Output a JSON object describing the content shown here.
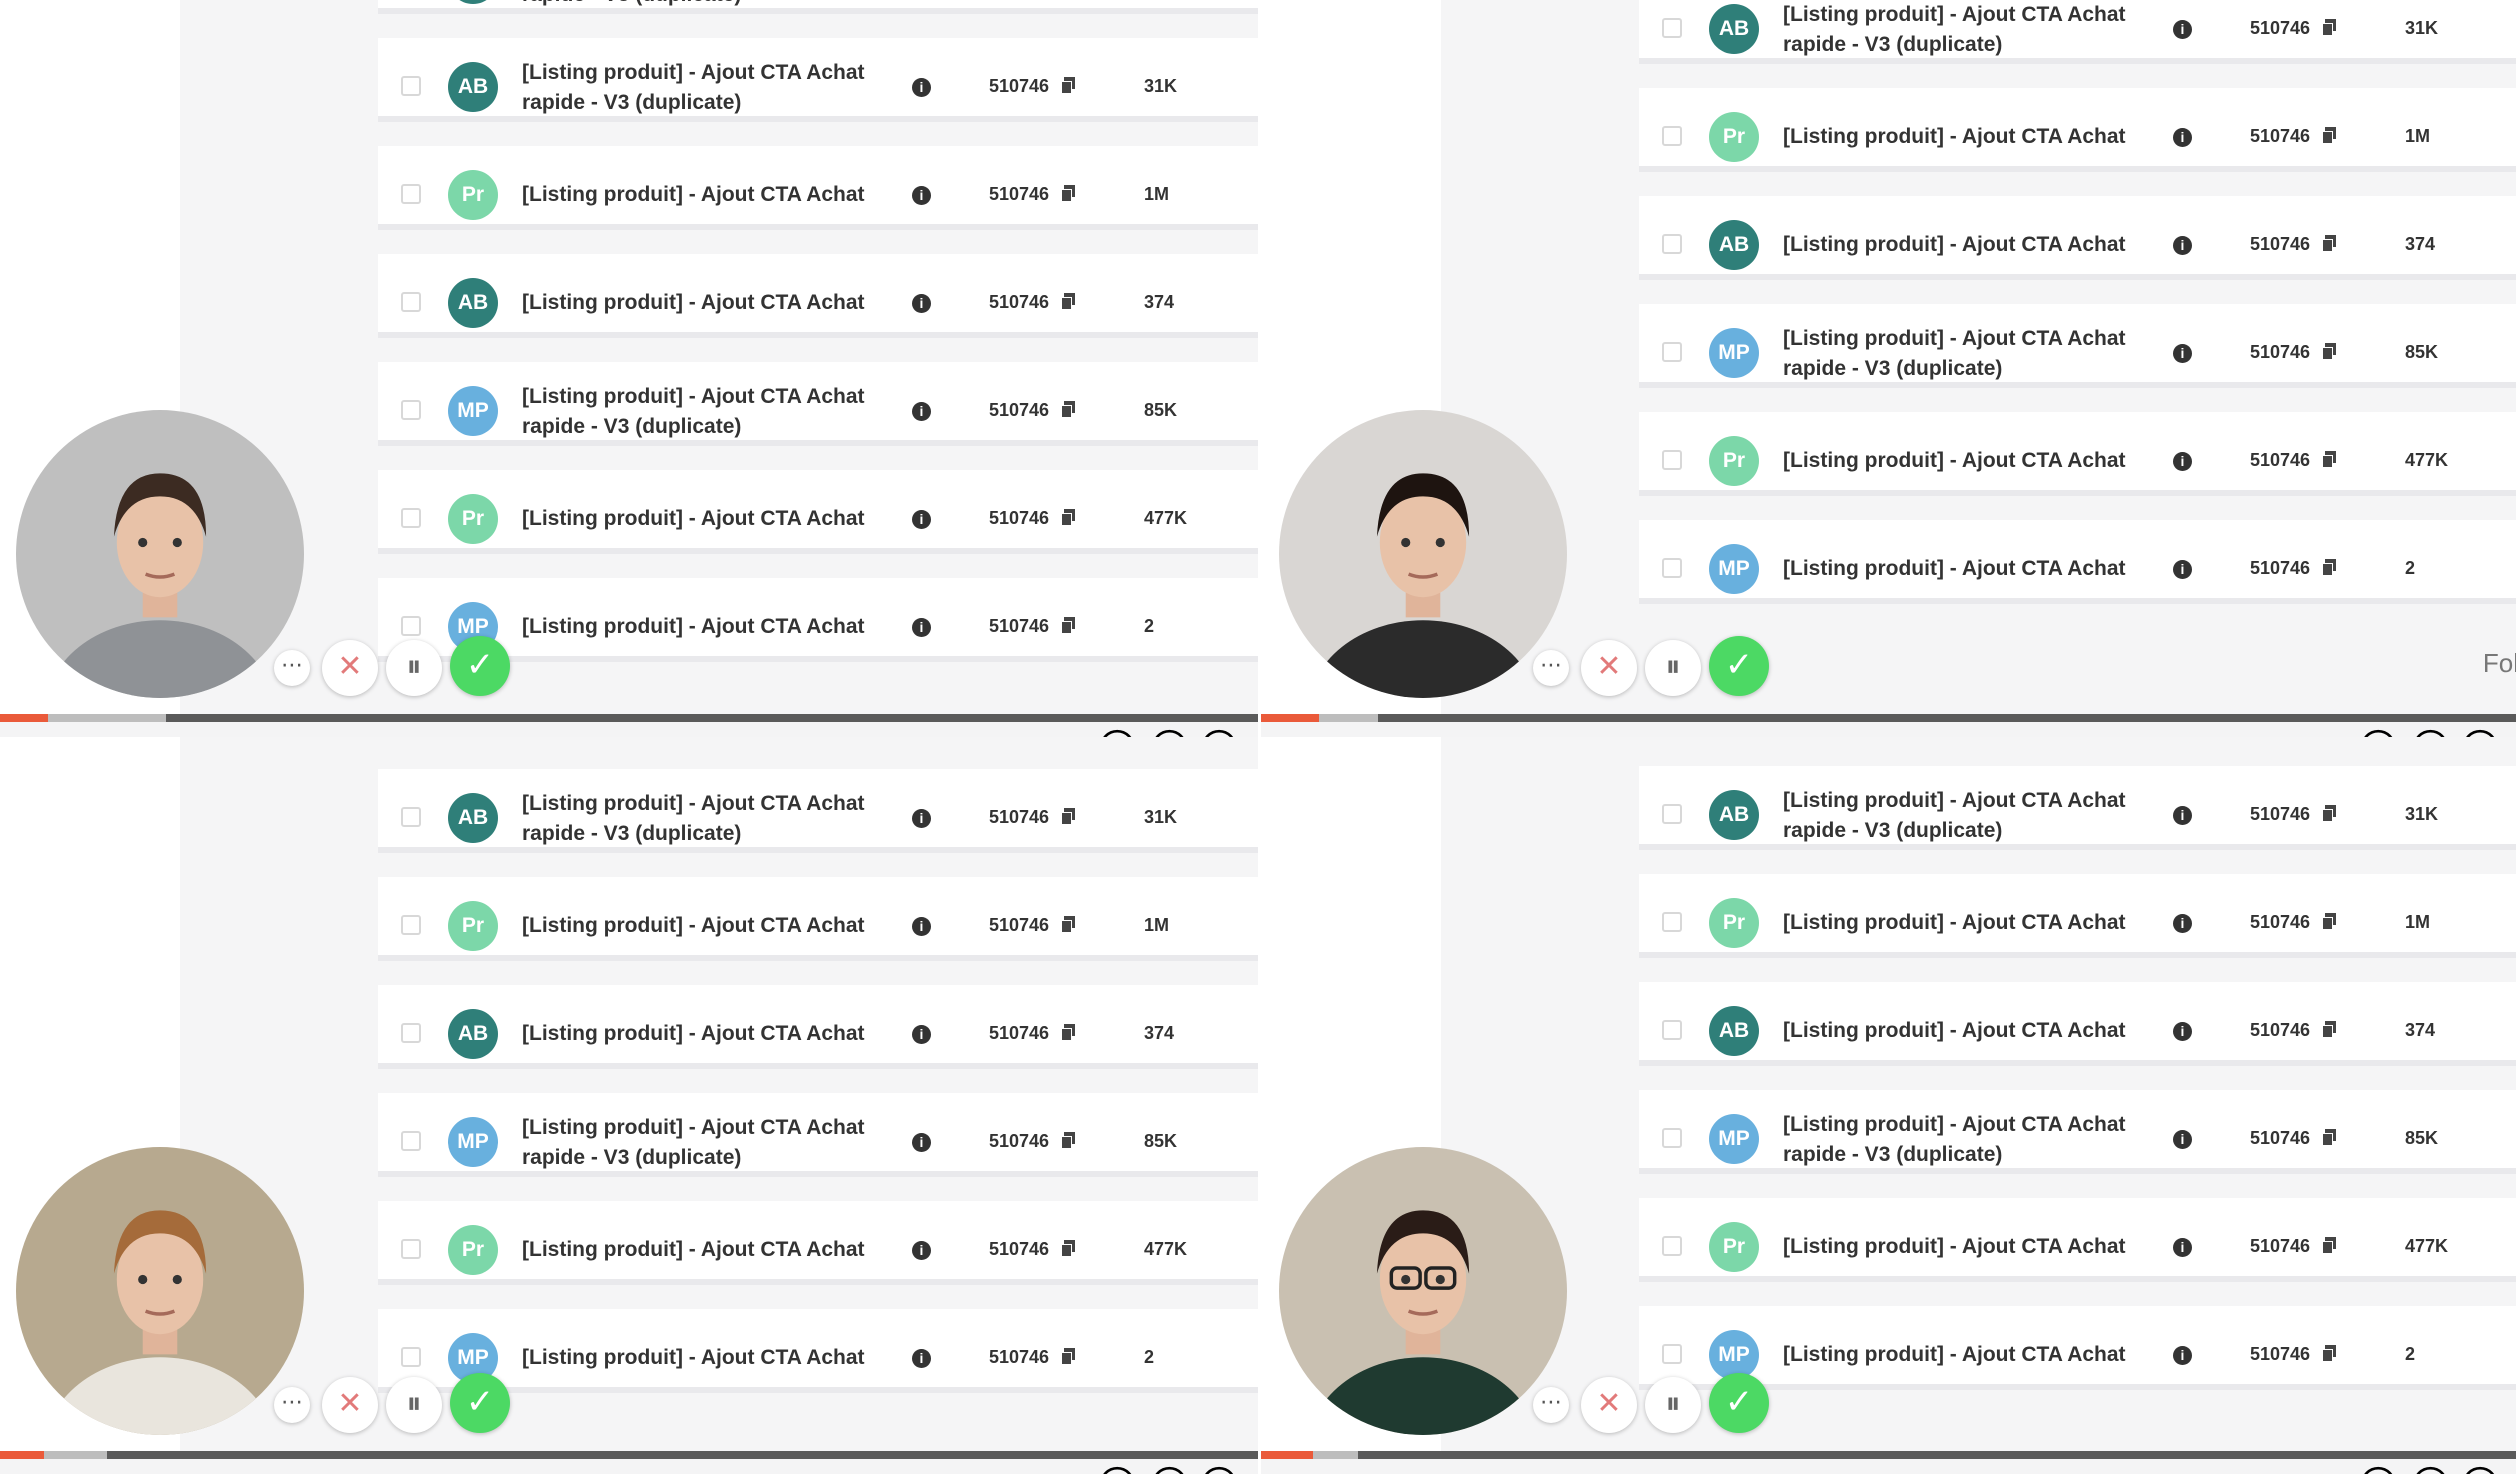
{
  "rows": [
    {
      "avatar": "AB",
      "avatar_type": "ab",
      "title": "[Listing produit] - Ajout CTA Achat rapide - V3 (duplicate)",
      "id": "510746",
      "count": "31K"
    },
    {
      "avatar": "Pr",
      "avatar_type": "pr",
      "title": "[Listing produit] - Ajout CTA Achat",
      "id": "510746",
      "count": "1M"
    },
    {
      "avatar": "AB",
      "avatar_type": "ab",
      "title": "[Listing produit] - Ajout CTA Achat",
      "id": "510746",
      "count": "374"
    },
    {
      "avatar": "MP",
      "avatar_type": "mp",
      "title": "[Listing produit] - Ajout CTA Achat rapide - V3 (duplicate)",
      "id": "510746",
      "count": "85K"
    },
    {
      "avatar": "Pr",
      "avatar_type": "pr",
      "title": "[Listing produit] - Ajout CTA Achat",
      "id": "510746",
      "count": "477K"
    },
    {
      "avatar": "MP",
      "avatar_type": "mp",
      "title": "[Listing produit] - Ajout CTA Achat",
      "id": "510746",
      "count": "2"
    }
  ],
  "panels": [
    {
      "name": "top-left",
      "progress": 0.038,
      "buffer": 0.132
    },
    {
      "name": "top-right",
      "progress": 0.046,
      "buffer": 0.093
    },
    {
      "name": "bottom-left",
      "progress": 0.035,
      "buffer": 0.085
    },
    {
      "name": "bottom-right",
      "progress": 0.041,
      "buffer": 0.077
    }
  ],
  "controls": {
    "more": "⋯",
    "close": "✕",
    "pause": "⏸",
    "check": "✓"
  },
  "edge_text": "Fol",
  "emojis": "😂😍😮",
  "colors": {
    "accent": "#ea5a3a",
    "check": "#4cd964",
    "ab": "#2f7f79",
    "pr": "#7cd7a9",
    "mp": "#68b0de"
  }
}
